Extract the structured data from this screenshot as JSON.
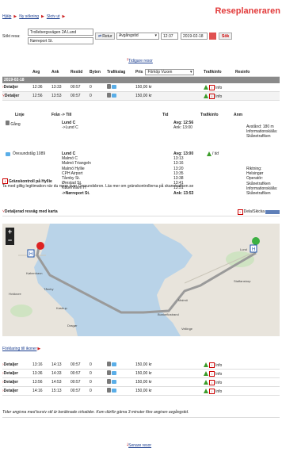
{
  "nav": {
    "home": "Hjälp",
    "new_search": "Ny sökning",
    "print": "Skriv ut",
    "sep": "▶"
  },
  "brand": "Reseplaneraren",
  "search": {
    "label": "Sökt resa:",
    "from": "Trollebergsvägen 2A Lund",
    "to": "Nørreport St.",
    "return_label": "Retur",
    "departure_mode": "Avgångstid",
    "time": "12:37",
    "date": "2019-02-18",
    "search_button": "Sök"
  },
  "earlier_link": "Tidigare resor",
  "table": {
    "headers": [
      "Avg",
      "Ank",
      "Restid",
      "Byten",
      "Trafikslag",
      "Pris",
      "Trafikinfo",
      "Resinfo"
    ],
    "price_select": "Förköp Vuxen",
    "date_row": "2019-02-18",
    "rows_top": [
      {
        "toggle": "Detaljer",
        "dep": "12:36",
        "arr": "13:33",
        "dur": "00:57",
        "chg": "0",
        "price": "150,00 kr",
        "info": "Info"
      },
      {
        "toggle": "Detaljer",
        "dep": "12:56",
        "arr": "13:53",
        "dur": "00:57",
        "chg": "0",
        "price": "150,00 kr",
        "info": "Info"
      }
    ]
  },
  "details": {
    "headers": [
      "Linje",
      "Från -> Till",
      "Tid",
      "Trafikinfo",
      "Anm"
    ],
    "legs": [
      {
        "line": "Gång",
        "from": "Lund C",
        "to": "->Lund C",
        "dep": "Avg: 12:56",
        "arr": "Ank: 13:00",
        "note1": "Avstånd: 180 m",
        "note2": "Informationskälla:",
        "note3": "Skånetrafiken"
      },
      {
        "line": "Öresundståg 1089",
        "stops": [
          "Lund C",
          "Malmö C",
          "Malmö Triangeln",
          "Malmö Hyllie",
          "CPH Airport",
          "Tårnby St.",
          "Ørestad St.",
          "København H",
          "->Nørreport St."
        ],
        "times": [
          "Avg: 13:00",
          "13:13",
          "13:16",
          "13:20",
          "13:35",
          "13:38",
          "13:41",
          "13:51",
          "Ank: 13:53"
        ],
        "status": "I tid",
        "notes": [
          "Riktning:",
          "Helsingør",
          "Operatör:",
          "Skånetrafiken",
          "Informationskälla:",
          "Skånetrafiken"
        ]
      }
    ]
  },
  "border_notice": {
    "title": "Gränskontroll på Hyllie",
    "text": "Ta med giltig legitimation när du reser över Öresundsbron. Läs mer om gränskontrollerna på skanetrafiken.se"
  },
  "map_toggle": "Detaljerad resväg med karta",
  "share_label": "Dela/Skicka",
  "map": {
    "zoom_in": "+",
    "zoom_out": "−",
    "labels": [
      "Malmö",
      "Lund",
      "København",
      "Kastrup",
      "Dragør",
      "Staffanstorp",
      "Bunkeflostrand",
      "Hvidovre",
      "Vellinge",
      "Tårnby"
    ]
  },
  "icons_link": "Förklaring till ikoner",
  "rows_bottom": [
    {
      "toggle": "Detaljer",
      "dep": "13:16",
      "arr": "14:13",
      "dur": "00:57",
      "chg": "0",
      "price": "150,00 kr",
      "info": "Info"
    },
    {
      "toggle": "Detaljer",
      "dep": "13:36",
      "arr": "14:33",
      "dur": "00:57",
      "chg": "0",
      "price": "150,00 kr",
      "info": "Info"
    },
    {
      "toggle": "Detaljer",
      "dep": "13:56",
      "arr": "14:53",
      "dur": "00:57",
      "chg": "0",
      "price": "150,00 kr",
      "info": "Info"
    },
    {
      "toggle": "Detaljer",
      "dep": "14:16",
      "arr": "15:13",
      "dur": "00:57",
      "chg": "0",
      "price": "150,00 kr",
      "info": "Info"
    }
  ],
  "footnote": "Tider angivna med kursiv stil är beräknade cirkatider. Kom därför gärna 3 minuter före angiven avgångstid.",
  "later_link": "Senare resor"
}
